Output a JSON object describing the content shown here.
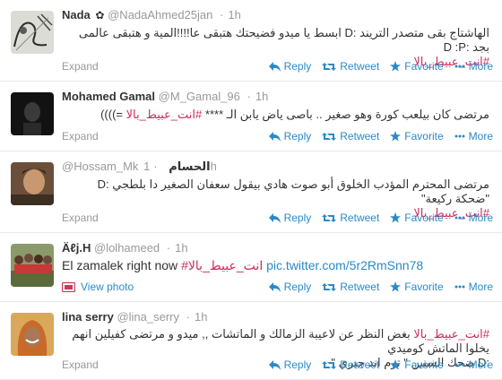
{
  "actions": {
    "expand": "Expand",
    "reply": "Reply",
    "retweet": "Retweet",
    "favorite": "Favorite",
    "more": "More",
    "view_photo": "View photo"
  },
  "colors": {
    "link": "#2a8ac8",
    "hashtag": "#cc2a5a",
    "muted": "#999999"
  },
  "tweets": [
    {
      "name": "Nada",
      "badge": "✿",
      "handle": "@NadaAhmed25jan",
      "time": "1h",
      "line1": "الهاشتاج بقى متصدر التريند :D ابسط يا ميدو فضيحتك هتبقى عا!!!!المية و هتبقى عالمى بجد :D :P",
      "tag": "#انت_عبيط_بالا"
    },
    {
      "name": "Mohamed Gamal",
      "handle": "@M_Gamal_96",
      "time": "1h",
      "line1_prefix": "مرتضى كان بيلعب كورة وهو صغير .. باصى ياض يابن الـ ****",
      "tag": "#انت_عبيط_بالا",
      "line1_suffix": "=))))"
    },
    {
      "name": "الحسام",
      "handle": "@Hossam_Mk",
      "time": "1h",
      "line1": "مرتضى المحترم المؤدب الخلوق أبو صوت هادي بيقول سعفان الصغير دا بلطجي :D \"ضحكة ركيعة\"",
      "tag": "#انت_عبيط_بالا"
    },
    {
      "name": "Äℓj.H",
      "handle": "@lolhameed",
      "time": "1h",
      "text_prefix": "El zamalek right now",
      "tag": "#انت_عبيط_بالا",
      "link": "pic.twitter.com/5r2RmSnn78"
    },
    {
      "name": "lina serry",
      "handle": "@lina_serry",
      "time": "1h",
      "tag": "#انت_عبيط_بالا",
      "line1": "بغض النظر عن لاعيبة الزمالك و الماتشات ,, ميدو و مرتضى كفيلين انهم يخلوا الماتش كوميدي",
      "line2": ":D ضحك السنين \" توم اند جيري \""
    }
  ]
}
